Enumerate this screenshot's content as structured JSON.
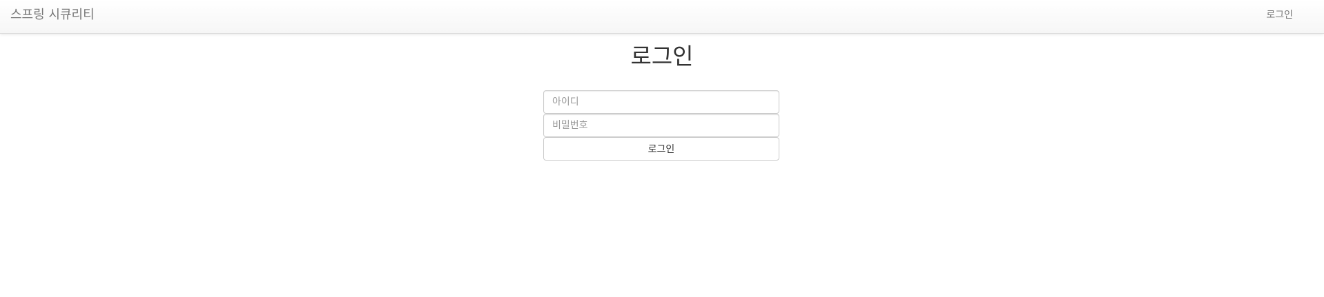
{
  "navbar": {
    "brand": "스프링 시큐리티",
    "login_link": "로그인"
  },
  "main": {
    "title": "로그인",
    "form": {
      "username_placeholder": "아이디",
      "username_value": "",
      "password_placeholder": "비밀번호",
      "password_value": "",
      "submit_label": "로그인"
    }
  },
  "colors": {
    "navbar_bg": "#f8f8f8",
    "nav_text": "#777777",
    "border": "#cccccc"
  }
}
